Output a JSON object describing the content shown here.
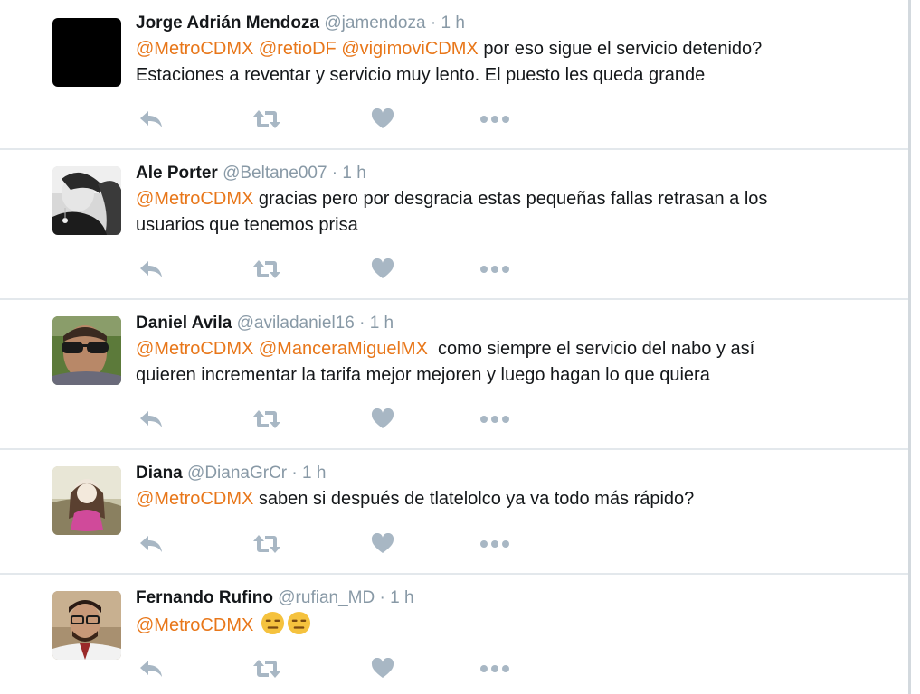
{
  "colors": {
    "mention": "#e8771a",
    "handle": "#8899a6",
    "icon": "#a8b7c4",
    "divider": "#e3e8ec"
  },
  "icons": {
    "reply": "reply-icon",
    "retweet": "retweet-icon",
    "like": "heart-icon",
    "more": "more-dots-icon"
  },
  "tweets": [
    {
      "name": "Jorge Adrián Mendoza",
      "handle": "@jamendoza",
      "sep": " · ",
      "time": "1 h",
      "mentions": [
        "@MetroCDMX",
        "@retioDF",
        "@vigimoviCDMX"
      ],
      "line1_rest": "por eso sigue el servicio detenido?",
      "line2": "Estaciones a reventar y servicio muy lento. El puesto les queda grande"
    },
    {
      "name": "Ale Porter",
      "handle": "@Beltane007",
      "sep": " · ",
      "time": "1 h",
      "mentions": [
        "@MetroCDMX"
      ],
      "line1_rest": "gracias pero por desgracia estas pequeñas fallas retrasan a los",
      "line2": "usuarios que tenemos prisa"
    },
    {
      "name": "Daniel Avila",
      "handle": "@aviladaniel16",
      "sep": " · ",
      "time": "1 h",
      "mentions": [
        "@MetroCDMX",
        "@ManceraMiguelMX"
      ],
      "line1_rest": "como siempre el servicio del nabo y así",
      "line2": "quieren incrementar la tarifa mejor mejoren y luego hagan lo que quiera"
    },
    {
      "name": "Diana",
      "handle": "@DianaGrCr",
      "sep": " · ",
      "time": "1 h",
      "mentions": [
        "@MetroCDMX"
      ],
      "line1_rest": "saben si después de tlatelolco ya va todo más rápido?"
    },
    {
      "name": "Fernando Rufino",
      "handle": "@rufian_MD",
      "sep": " · ",
      "time": "1 h",
      "mentions": [
        "@MetroCDMX"
      ],
      "emojis": [
        "expressionless-face-emoji",
        "expressionless-face-emoji"
      ]
    }
  ]
}
